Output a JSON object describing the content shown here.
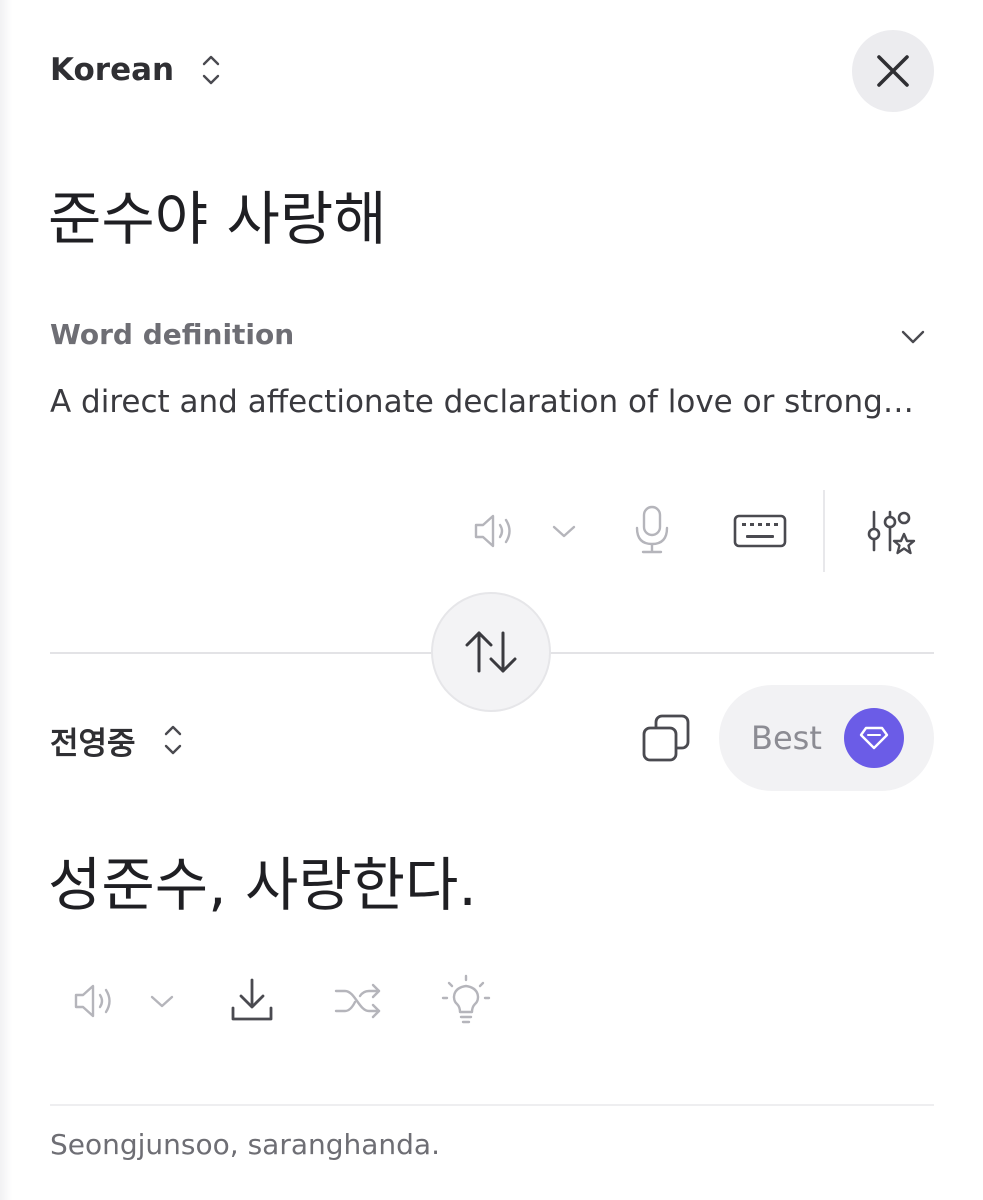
{
  "source": {
    "language": "Korean",
    "text": "준수야 사랑해",
    "definition_header": "Word definition",
    "definition_text": "A direct and affectionate declaration of love or strong…"
  },
  "target": {
    "language": "전영중",
    "text": "성준수, 사랑한다.",
    "quality_label": "Best",
    "romanization": "Seongjunsoo, saranghanda."
  },
  "colors": {
    "accent": "#6b5ce7",
    "icon_muted": "#b5b5bb",
    "icon_dark": "#4a4a50"
  }
}
